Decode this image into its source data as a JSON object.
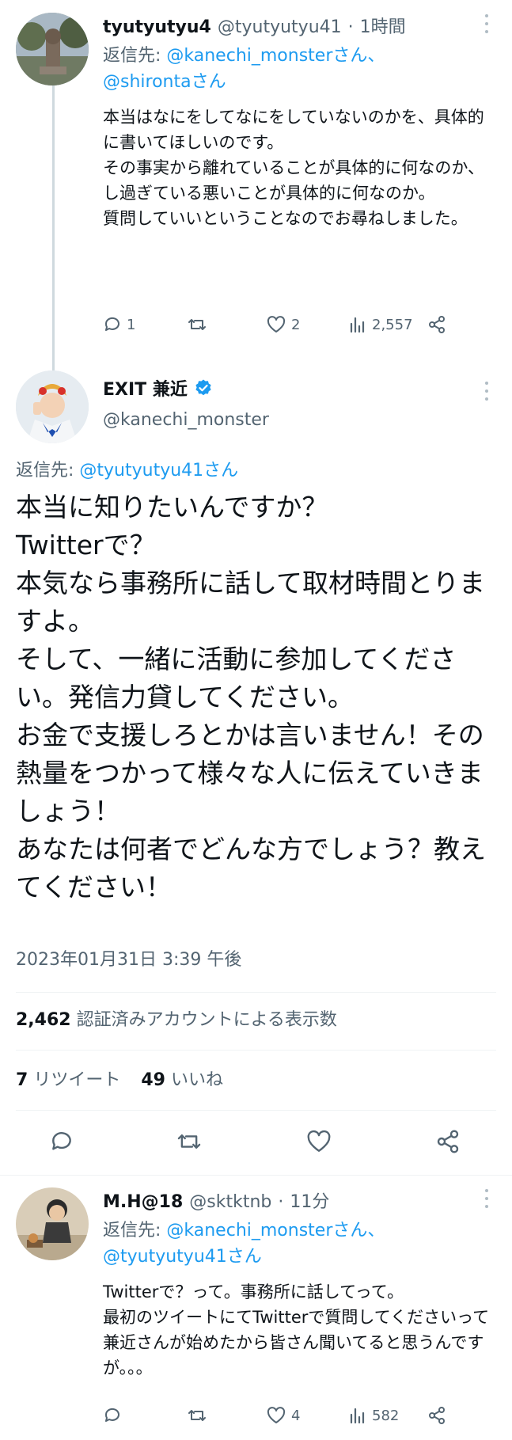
{
  "tweet1": {
    "name": "tyutyutyu4",
    "handle": "@tyutyutyu41",
    "sep": "·",
    "time": "1時間",
    "reply_prefix": "返信先: ",
    "reply_users": "@kanechi_monsterさん、@shirontaさん",
    "reply_user1": "@kanechi_monsterさん、",
    "reply_user2": "@shirontaさん",
    "text": "本当はなにをしてなにをしていないのかを、具体的に書いてほしいのです。\nその事実から離れていることが具体的に何なのか、し過ぎている悪いことが具体的に何なのか。\n質問していいということなのでお尋ねしました。",
    "replies": "1",
    "retweets": "",
    "likes": "2",
    "views": "2,557"
  },
  "main": {
    "name": "EXIT 兼近",
    "verified": true,
    "handle": "@kanechi_monster",
    "reply_prefix": "返信先: ",
    "reply_user": "@tyutyutyu41さん",
    "text": "本当に知りたいんですか？\nTwitterで？\n本気なら事務所に話して取材時間とりますよ。\nそして、一緒に活動に参加してください。発信力貸してください。\nお金で支援しろとかは言いません！その熱量をつかって様々な人に伝えていきましょう！\nあなたは何者でどんな方でしょう？教えてください！",
    "timestamp": "2023年01月31日 3:39 午後",
    "views_num": "2,462",
    "views_label": "認証済みアカウントによる表示数",
    "retweets_num": "7",
    "retweets_label": "リツイート",
    "likes_num": "49",
    "likes_label": "いいね"
  },
  "tweet3": {
    "name": "M.H@18",
    "handle": "@sktktnb",
    "sep": "·",
    "time": "11分",
    "reply_prefix": "返信先: ",
    "reply_user1": "@kanechi_monsterさん、",
    "reply_user2": "@tyutyutyu41さん",
    "text": "Twitterで？って。事務所に話してって。\n最初のツイートにてTwitterで質問してくださいって兼近さんが始めたから皆さん聞いてると思うんですが。。。",
    "replies": "",
    "retweets": "",
    "likes": "4",
    "views": "582"
  },
  "colors": {
    "link": "#1d9bf0",
    "muted": "#536471",
    "text": "#0f1419",
    "verified": "#1d9bf0"
  }
}
